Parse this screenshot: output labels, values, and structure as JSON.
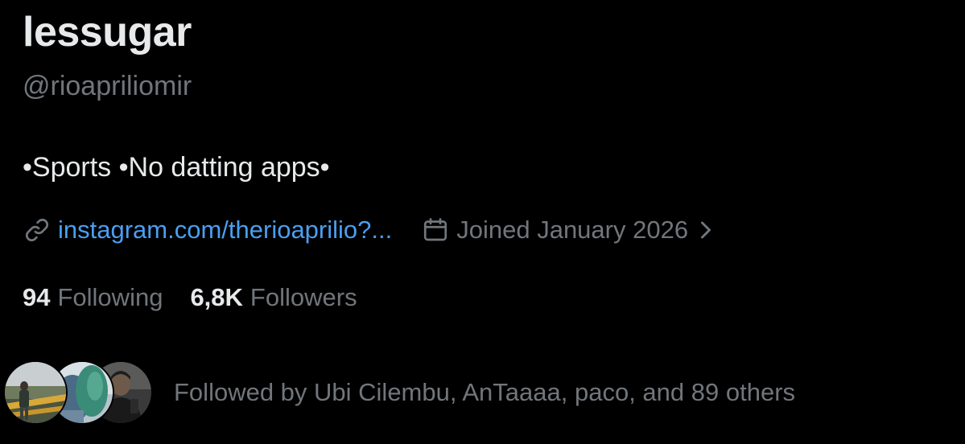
{
  "profile": {
    "display_name": "lessugar",
    "handle": "@rioapriliomir",
    "bio": "•Sports •No datting apps•",
    "link": {
      "icon": "link-icon",
      "text": "instagram.com/therioaprilio?..."
    },
    "joined": {
      "icon": "calendar-icon",
      "text": "Joined January 2026",
      "chevron_icon": "chevron-right-icon"
    },
    "stats": {
      "following_count": "94",
      "following_label": "Following",
      "followers_count": "6,8K",
      "followers_label": "Followers"
    },
    "followed_by": {
      "text": "Followed by Ubi Cilembu, AnTaaaa, paco, and 89 others",
      "avatars": [
        "avatar-ubi-cilembu",
        "avatar-antaaaa",
        "avatar-paco"
      ]
    }
  },
  "colors": {
    "background": "#000000",
    "primary_text": "#e7e9ea",
    "secondary_text": "#71767b",
    "link": "#4a9ff0"
  }
}
